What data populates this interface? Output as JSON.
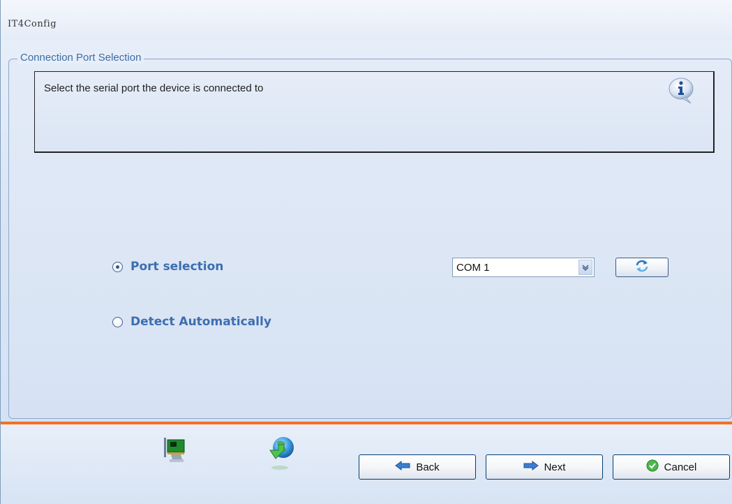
{
  "window": {
    "title": "IT4Config"
  },
  "group": {
    "legend": "Connection Port Selection"
  },
  "info": {
    "text": "Select the serial port the device is connected to",
    "icon": "info-icon"
  },
  "options": {
    "port_selection_label": "Port selection",
    "port_selection_checked": true,
    "detect_auto_label": "Detect Automatically",
    "detect_auto_checked": false
  },
  "port_combo": {
    "value": "COM 1",
    "icon": "chevron-down-icon"
  },
  "refresh_button": {
    "icon": "refresh-icon"
  },
  "footer": {
    "icons": [
      "serial-device-icon",
      "download-globe-icon"
    ],
    "back_label": "Back",
    "next_label": "Next",
    "cancel_label": "Cancel"
  },
  "colors": {
    "accent": "#f37021",
    "label_blue": "#3c6eb0",
    "panel": "#d6e2f3"
  }
}
